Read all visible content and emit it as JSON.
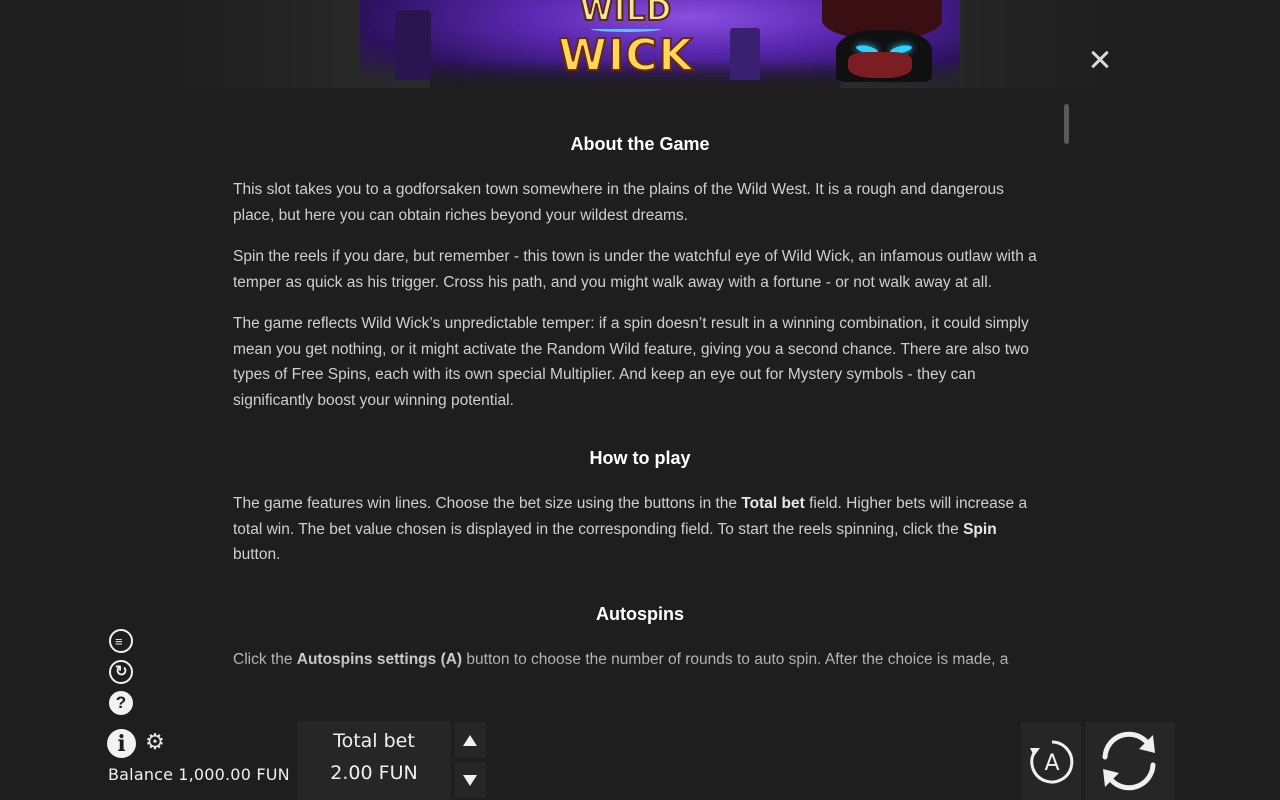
{
  "banner": {
    "logo_line1": "WILD",
    "logo_line2": "WICK"
  },
  "sections": [
    {
      "title": "About the Game",
      "paragraphs": [
        "This slot takes you to a godforsaken town somewhere in the plains of the Wild West. It is a rough and dangerous place, but here you can obtain riches beyond your wildest dreams.",
        "Spin the reels if you dare, but remember - this town is under the watchful eye of Wild Wick, an infamous outlaw with a temper as quick as his trigger. Cross his path, and you might walk away with a fortune - or not walk away at all.",
        "The game reflects Wild Wick’s unpredictable temper: if a spin doesn’t result in a winning combination, it could simply mean you get nothing, or it might activate the Random Wild feature, giving you a second chance. There are also two types of Free Spins, each with its own special Multiplier. And keep an eye out for Mystery symbols - they can significantly boost your winning potential."
      ]
    },
    {
      "title": "How to play",
      "p1_a": "The game features win lines. Choose the bet size using the buttons in the ",
      "p1_b1": "Total bet",
      "p1_c": " field. Higher bets will increase a total win. The bet value chosen is displayed in the corresponding field. To start the reels spinning, click the ",
      "p1_b2": "Spin",
      "p1_d": " button."
    },
    {
      "title": "Autospins",
      "p1_a": "Click the ",
      "p1_b1": "Autospins settings (A)",
      "p1_c": " button to choose the number of rounds to auto spin. After the choice is made, a"
    }
  ],
  "footer": {
    "balance_label": "Balance",
    "balance_value": "1,000.00 FUN",
    "total_bet_label": "Total bet",
    "total_bet_value": "2.00 FUN",
    "autospin_letter": "A"
  },
  "icons": {
    "close": "close-icon",
    "turbo": "turbo-icon",
    "quick": "quick-spin-icon",
    "help": "help-icon",
    "info": "info-icon",
    "settings": "gear-icon",
    "bet_up": "arrow-up-icon",
    "bet_down": "arrow-down-icon",
    "autospin": "autospin-icon",
    "spin": "spin-icon"
  }
}
